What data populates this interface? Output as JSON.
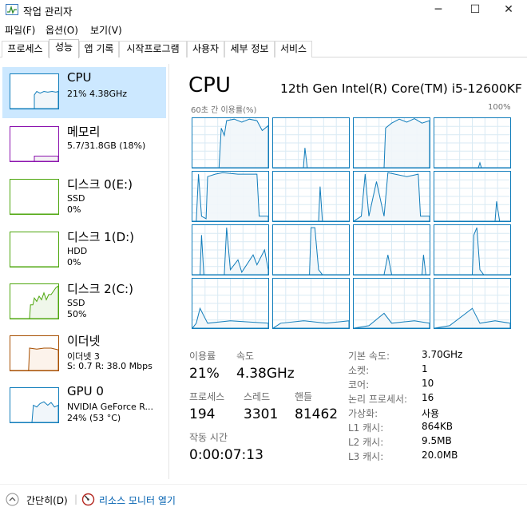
{
  "window": {
    "title": "작업 관리자",
    "minimize_glyph": "─",
    "maximize_glyph": "☐",
    "close_glyph": "✕"
  },
  "menu": [
    "파일(F)",
    "옵션(O)",
    "보기(V)"
  ],
  "tabs": [
    "프로세스",
    "성능",
    "앱 기록",
    "시작프로그램",
    "사용자",
    "세부 정보",
    "서비스"
  ],
  "active_tab": "성능",
  "sidebar": [
    {
      "title": "CPU",
      "line1": "21% 4.38GHz",
      "line2": "",
      "color": "#117dbb",
      "fill": "#f1f6fa"
    },
    {
      "title": "메모리",
      "line1": "5.7/31.8GB (18%)",
      "line2": "",
      "color": "#8b12ae",
      "fill": "#f4f2f4"
    },
    {
      "title": "디스크 0(E:)",
      "line1": "SSD",
      "line2": "0%",
      "color": "#4da60c",
      "fill": "#eff7ea"
    },
    {
      "title": "디스크 1(D:)",
      "line1": "HDD",
      "line2": "0%",
      "color": "#4da60c",
      "fill": "#eff7ea"
    },
    {
      "title": "디스크 2(C:)",
      "line1": "SSD",
      "line2": "50%",
      "color": "#4da60c",
      "fill": "#eff7ea"
    },
    {
      "title": "이더넷",
      "line1": "이더넷 3",
      "line2": "S: 0.7  R: 38.0 Mbps",
      "color": "#a74f01",
      "fill": "#fcf3eb"
    },
    {
      "title": "GPU 0",
      "line1": "NVIDIA GeForce R...",
      "line2": "24% (53 °C)",
      "color": "#117dbb",
      "fill": "#f1f6fa"
    }
  ],
  "main": {
    "title": "CPU",
    "model": "12th Gen Intel(R) Core(TM) i5-12600KF",
    "graph_label_left": "60초 간 이용률(%)",
    "graph_label_right": "100%",
    "stats": {
      "usage_label": "이용률",
      "usage_value": "21%",
      "speed_label": "속도",
      "speed_value": "4.38GHz",
      "processes_label": "프로세스",
      "processes_value": "194",
      "threads_label": "스레드",
      "threads_value": "3301",
      "handles_label": "핸들",
      "handles_value": "81462",
      "uptime_label": "작동 시간",
      "uptime_value": "0:00:07:13"
    },
    "details": [
      {
        "label": "기본 속도:",
        "value": "3.70GHz"
      },
      {
        "label": "소켓:",
        "value": "1"
      },
      {
        "label": "코어:",
        "value": "10"
      },
      {
        "label": "논리 프로세서:",
        "value": "16"
      },
      {
        "label": "가상화:",
        "value": "사용"
      },
      {
        "label": "L1 캐시:",
        "value": "864KB"
      },
      {
        "label": "L2 캐시:",
        "value": "9.5MB"
      },
      {
        "label": "L3 캐시:",
        "value": "20.0MB"
      }
    ]
  },
  "footer": {
    "fewer_details": "간단히(D)",
    "resource_monitor": "리소스 모니터 열기"
  },
  "colors": {
    "cpu_line": "#117dbb",
    "cpu_fill": "#f1f6fa",
    "selected_bg": "#cce8ff",
    "grid": "#d9eaf4"
  }
}
